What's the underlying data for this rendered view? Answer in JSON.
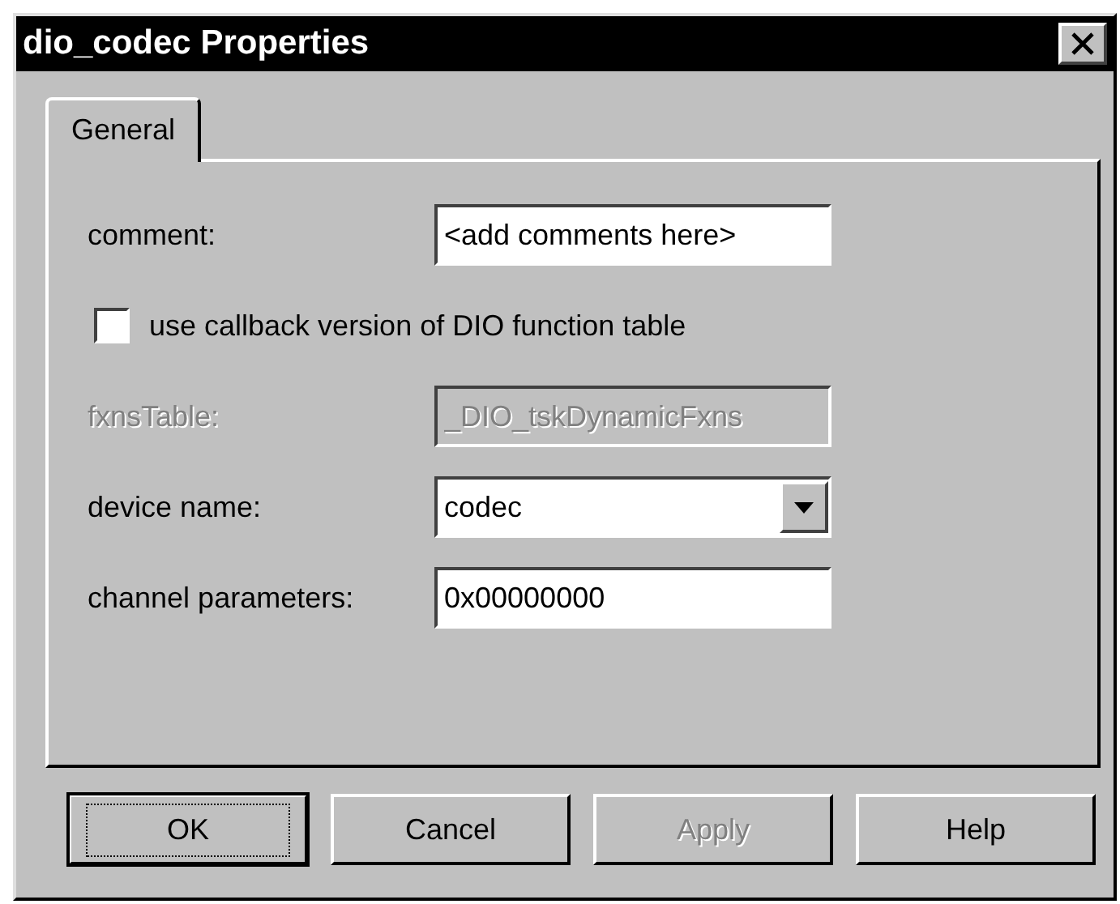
{
  "window": {
    "title": "dio_codec Properties"
  },
  "tabs": [
    {
      "label": "General",
      "selected": true
    }
  ],
  "fields": [
    {
      "kind": "text",
      "label": "comment:",
      "value": "<add comments here>",
      "disabled": false
    },
    {
      "kind": "checkbox",
      "label": "use callback version of DIO function table",
      "checked": false
    },
    {
      "kind": "text",
      "label": "fxnsTable:",
      "value": "_DIO_tskDynamicFxns",
      "disabled": true
    },
    {
      "kind": "dropdown",
      "label": "device name:",
      "value": "codec"
    },
    {
      "kind": "text",
      "label": "channel parameters:",
      "value": "0x00000000",
      "disabled": false
    }
  ],
  "buttons": [
    {
      "label": "OK",
      "default": true,
      "disabled": false
    },
    {
      "label": "Cancel",
      "default": false,
      "disabled": false
    },
    {
      "label": "Apply",
      "default": false,
      "disabled": true
    },
    {
      "label": "Help",
      "default": false,
      "disabled": false
    }
  ]
}
